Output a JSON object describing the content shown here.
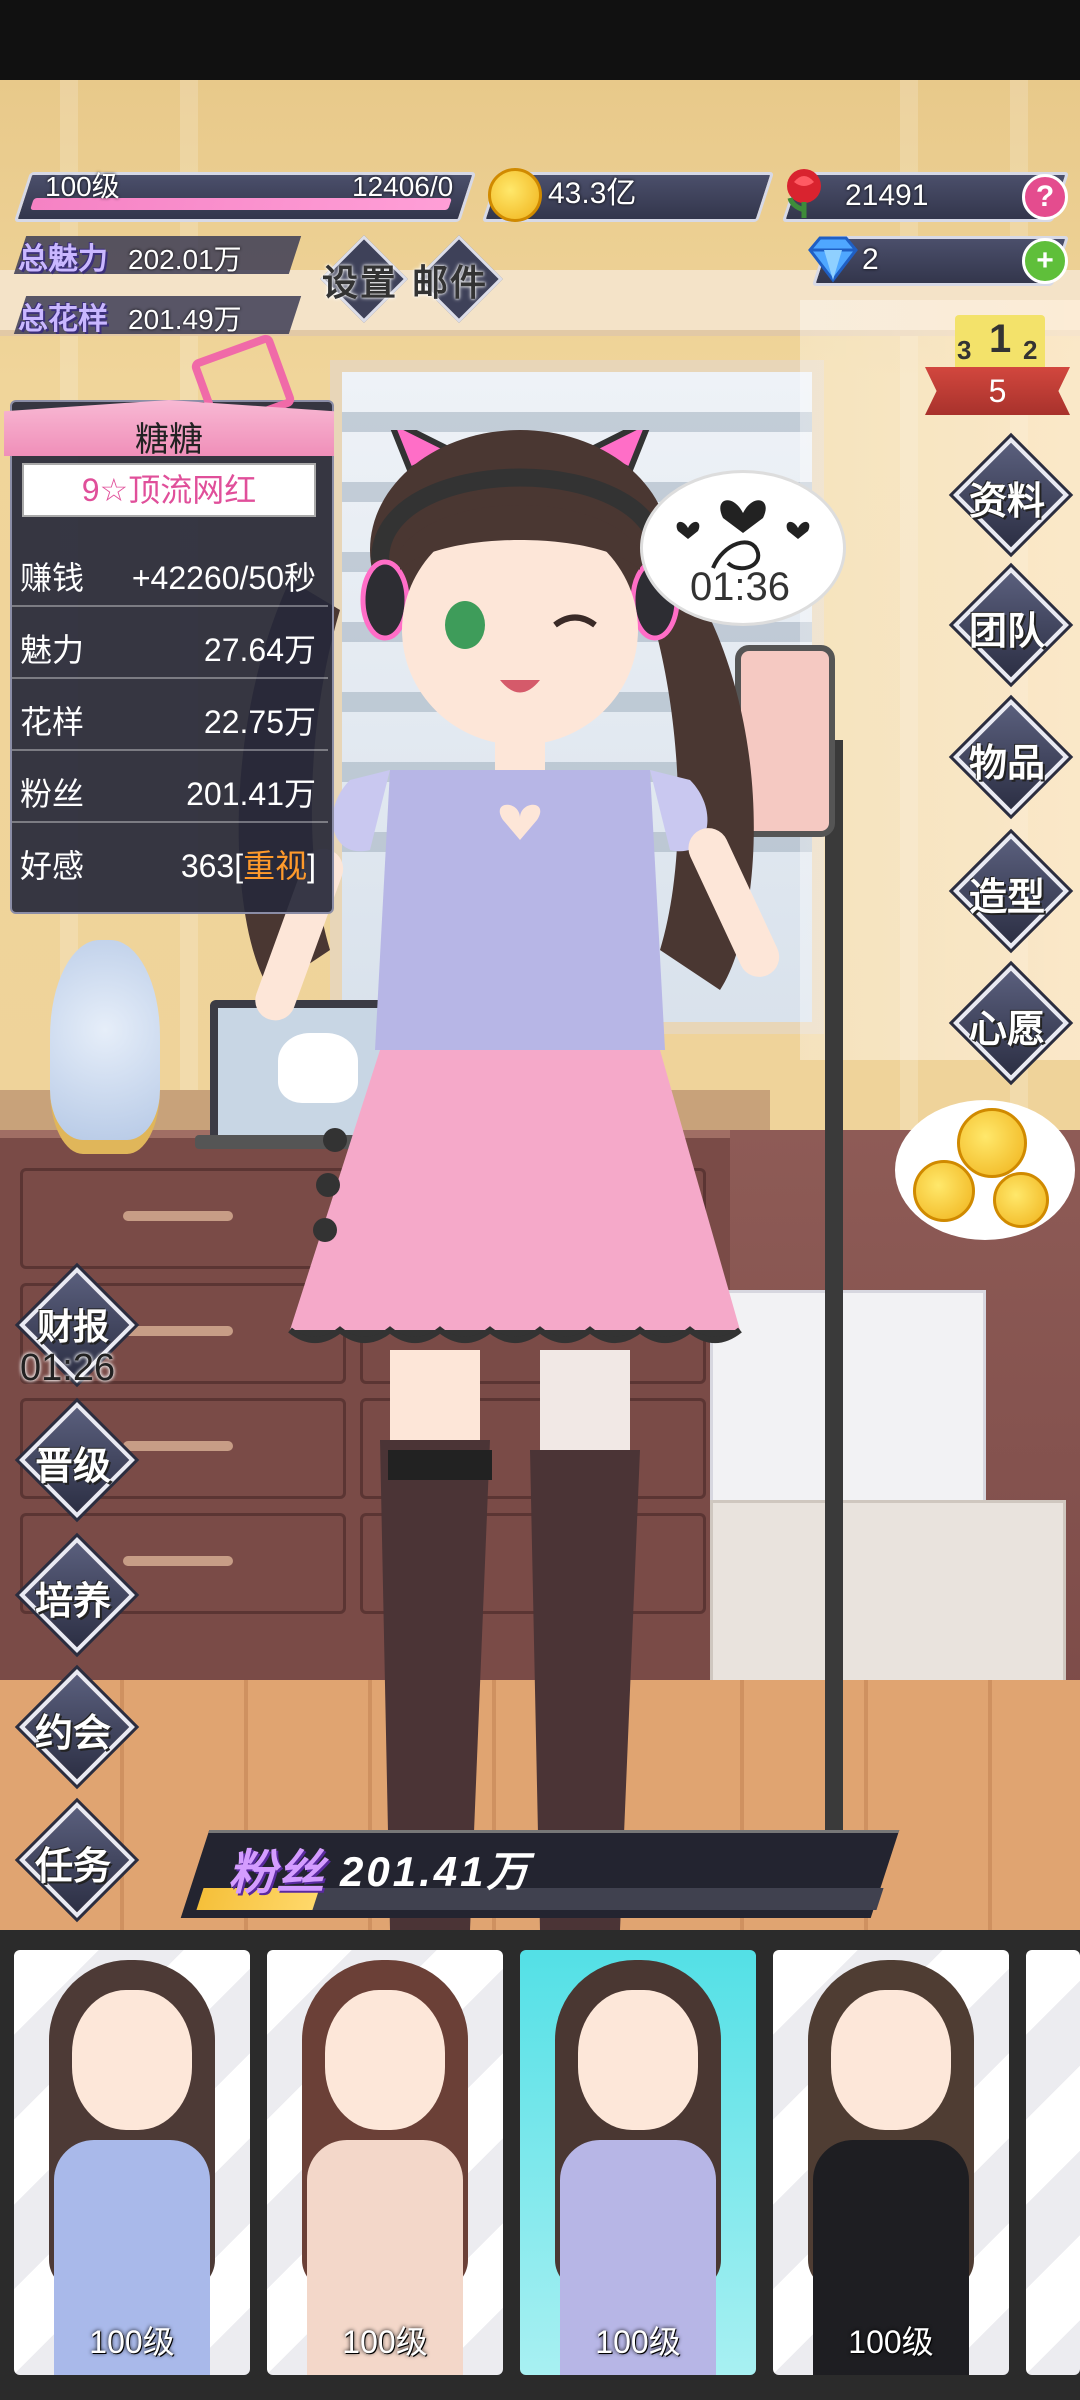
{
  "hud": {
    "level": "100级",
    "exp": "12406/0",
    "gold": "43.3亿",
    "roses": "21491",
    "diamonds": "2",
    "help_btn": "?",
    "add_btn": "+",
    "total_charm_label": "总魅力",
    "total_charm_value": "202.01万",
    "total_style_label": "总花样",
    "total_style_value": "201.49万",
    "settings": "设置",
    "mail": "邮件",
    "rank_digits": [
      "3",
      "1",
      "2"
    ],
    "rank": "5"
  },
  "info": {
    "name": "糖糖",
    "title": "9☆顶流网红",
    "rows": [
      {
        "k": "赚钱",
        "v": "+42260/50秒"
      },
      {
        "k": "魅力",
        "v": "27.64万"
      },
      {
        "k": "花样",
        "v": "22.75万"
      },
      {
        "k": "粉丝",
        "v": "201.41万"
      }
    ],
    "affection_label": "好感",
    "affection_value": "363",
    "affection_emph": "重视"
  },
  "right_menu": [
    "资料",
    "团队",
    "物品",
    "造型",
    "心愿"
  ],
  "left_menu": {
    "report": "财报",
    "report_time": "01:26",
    "items": [
      "晋级",
      "培养",
      "约会",
      "任务"
    ]
  },
  "heart_timer": "01:36",
  "fans": {
    "label": "粉丝",
    "value": "201.41万",
    "progress": 0.17
  },
  "cards": [
    {
      "level": "100级",
      "hair": "#4d3a36",
      "outfit": "#a9b9ea",
      "selected": false
    },
    {
      "level": "100级",
      "hair": "#6b4037",
      "outfit": "#f3d7c9",
      "selected": false
    },
    {
      "level": "100级",
      "hair": "#4a3732",
      "outfit": "#b7b6e6",
      "selected": true
    },
    {
      "level": "100级",
      "hair": "#4f3d33",
      "outfit": "#1e1e22",
      "selected": false
    }
  ],
  "colors": {
    "accent_pink": "#f08fb9",
    "panel_dark": "#26283a",
    "gold": "#f0b21a"
  }
}
